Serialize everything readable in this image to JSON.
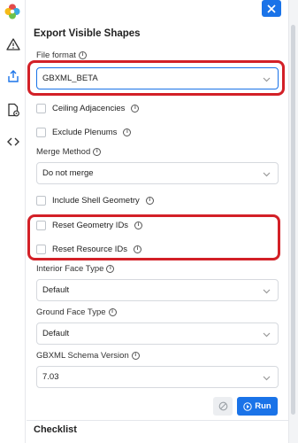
{
  "panel": {
    "title": "Export Visible Shapes",
    "file_format": {
      "label": "File format",
      "value": "GBXML_BETA"
    },
    "ceiling_adjacencies": {
      "label": "Ceiling Adjacencies",
      "checked": false
    },
    "exclude_plenums": {
      "label": "Exclude Plenums",
      "checked": false
    },
    "merge_method": {
      "label": "Merge Method",
      "value": "Do not merge"
    },
    "include_shell_geometry": {
      "label": "Include Shell Geometry",
      "checked": false
    },
    "reset_geometry_ids": {
      "label": "Reset Geometry IDs",
      "checked": false
    },
    "reset_resource_ids": {
      "label": "Reset Resource IDs",
      "checked": false
    },
    "interior_face_type": {
      "label": "Interior Face Type",
      "value": "Default"
    },
    "ground_face_type": {
      "label": "Ground Face Type",
      "value": "Default"
    },
    "schema_version": {
      "label": "GBXML Schema Version",
      "value": "7.03"
    },
    "run_label": "Run",
    "checklist_title": "Checklist"
  },
  "rail": {
    "icons": [
      "app-logo-icon",
      "warning-icon",
      "export-icon",
      "document-settings-icon",
      "code-icon"
    ]
  },
  "colors": {
    "accent": "#1a73e8",
    "highlight": "#d32027"
  }
}
